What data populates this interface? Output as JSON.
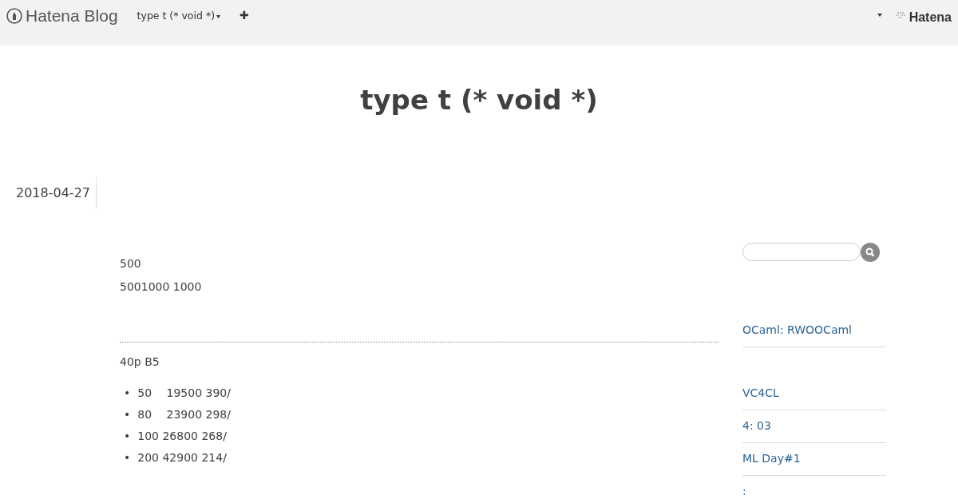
{
  "navbar": {
    "brand": "Hatena Blog",
    "blog_menu": "type t (* void *)",
    "add": "✚",
    "right_logo": "Hatena"
  },
  "blog_title": "type t (* void *)",
  "entry": {
    "date": "2018-04-27",
    "paragraphs": [
      "500",
      "5001000 1000"
    ],
    "section_text": "40p B5",
    "list": [
      {
        "bullet": "•",
        "text": "50　 19500 390/"
      },
      {
        "bullet": "•",
        "text": "80　 23900 298/"
      },
      {
        "bullet": "•",
        "text": "100 26800 268/"
      },
      {
        "bullet": "•",
        "text": "200 42900 214/"
      }
    ]
  },
  "sidebar": {
    "items": [
      "OCaml: RWOOCaml",
      "VC4CL",
      "4: 03",
      "ML Day#1",
      ":"
    ]
  }
}
